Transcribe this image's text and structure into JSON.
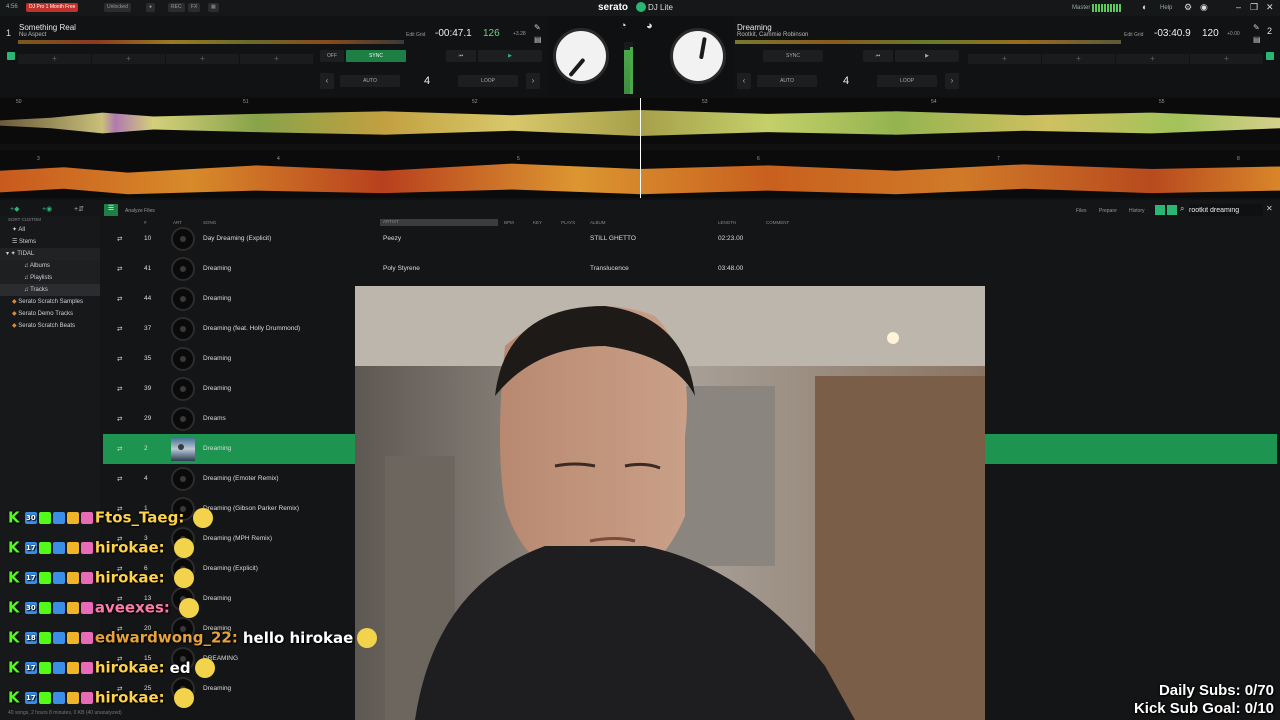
{
  "topbar": {
    "clock": "4:56",
    "promo": "DJ Pro 1 Month Free",
    "unlocked": "Unlocked",
    "rec": "REC",
    "fx": "FX",
    "brand": "serato",
    "product": "DJ Lite",
    "master": "Master",
    "help": "Help"
  },
  "deck_left": {
    "number": "1",
    "title": "Something Real",
    "artist": "Nu Aspect",
    "edit_grid": "Edit Grid",
    "time": "-00:47.1",
    "bpm": "126",
    "pitch": "+3.28",
    "off": "OFF",
    "sync": "SYNC",
    "auto": "AUTO",
    "loop_size": "4",
    "loop": "LOOP"
  },
  "deck_right": {
    "number": "2",
    "title": "Dreaming",
    "artist": "Rootkit, Cammie Robinson",
    "edit_grid": "Edit Grid",
    "time": "-03:40.9",
    "bpm": "120",
    "pitch": "+0.00",
    "sync": "SYNC",
    "auto": "AUTO",
    "loop_size": "4",
    "loop": "LOOP"
  },
  "waveform_top_markers": [
    "50",
    "51",
    "52",
    "53",
    "54",
    "55"
  ],
  "waveform_bottom_markers": [
    "3",
    "4",
    "5",
    "6",
    "7",
    "8"
  ],
  "library": {
    "toolbar": {
      "analyze_files": "Analyze Files",
      "files": "Files",
      "prepare": "Prepare",
      "history": "History",
      "search_value": "rootkit dreaming"
    },
    "sidebar": {
      "sort_label": "SORT CUSTOM",
      "items": [
        "All",
        "Stems",
        "TIDAL",
        "Albums",
        "Playlists",
        "Tracks",
        "Serato Scratch Samples",
        "Serato Demo Tracks",
        "Serato Scratch Beats"
      ]
    },
    "columns": {
      "number": "#",
      "art": "ART",
      "song": "SONG",
      "artist": "ARTIST",
      "bpm": "BPM",
      "key": "KEY",
      "plays": "PLAYS",
      "album": "ALBUM",
      "length": "LENGTH",
      "comment": "COMMENT"
    },
    "rows": [
      {
        "num": "10",
        "song": "Day Dreaming (Explicit)",
        "artist": "Peezy",
        "album": "STILL GHETTO",
        "length": "02:23.00"
      },
      {
        "num": "41",
        "song": "Dreaming",
        "artist": "Poly Styrene",
        "album": "Translucence",
        "length": "03:48.00"
      },
      {
        "num": "44",
        "song": "Dreaming",
        "artist": "",
        "album": "",
        "length": ""
      },
      {
        "num": "37",
        "song": "Dreaming (feat. Holly Drummond)",
        "artist": "",
        "album": "",
        "length": ""
      },
      {
        "num": "35",
        "song": "Dreaming",
        "artist": "",
        "album": "",
        "length": ""
      },
      {
        "num": "39",
        "song": "Dreaming",
        "artist": "",
        "album": "",
        "length": ""
      },
      {
        "num": "29",
        "song": "Dreams",
        "artist": "",
        "album": "",
        "length": ""
      },
      {
        "num": "2",
        "song": "Dreaming",
        "artist": "",
        "album": "",
        "length": ""
      },
      {
        "num": "4",
        "song": "Dreaming (Emoter Remix)",
        "artist": "",
        "album": "",
        "length": ""
      },
      {
        "num": "1",
        "song": "Dreaming (Gibson Parker Remix)",
        "artist": "",
        "album": "",
        "length": ""
      },
      {
        "num": "3",
        "song": "Dreaming (MPH Remix)",
        "artist": "",
        "album": "",
        "length": ""
      },
      {
        "num": "6",
        "song": "Dreaming (Explicit)",
        "artist": "",
        "album": "",
        "length": ""
      },
      {
        "num": "13",
        "song": "Dreaming",
        "artist": "",
        "album": "",
        "length": ""
      },
      {
        "num": "20",
        "song": "Dreaming",
        "artist": "",
        "album": "",
        "length": ""
      },
      {
        "num": "15",
        "song": "DREAMING",
        "artist": "",
        "album": "",
        "length": ""
      },
      {
        "num": "25",
        "song": "Dreaming",
        "artist": "",
        "album": "",
        "length": ""
      }
    ],
    "status": "40 songs, 2 hours 8 minutes, 0 KB (40 unanalyzed)"
  },
  "chat": [
    {
      "sub": "30",
      "user": "Ftos_Taeg:",
      "msg": ""
    },
    {
      "sub": "17",
      "user": "hirokae:",
      "msg": ""
    },
    {
      "sub": "17",
      "user": "hirokae:",
      "msg": ""
    },
    {
      "sub": "30",
      "user": "aveexes:",
      "msg": ""
    },
    {
      "sub": "18",
      "user": "edwardwong_22:",
      "msg": "hello hirokae"
    },
    {
      "sub": "17",
      "user": "hirokae:",
      "msg": "ed"
    },
    {
      "sub": "17",
      "user": "hirokae:",
      "msg": ""
    }
  ],
  "goals": {
    "daily": "Daily Subs: 0/70",
    "kick": "Kick Sub Goal: 0/10"
  },
  "colors": {
    "accent": "#1d9450",
    "username": "#ffd24a",
    "sync": "#1e7f45"
  }
}
